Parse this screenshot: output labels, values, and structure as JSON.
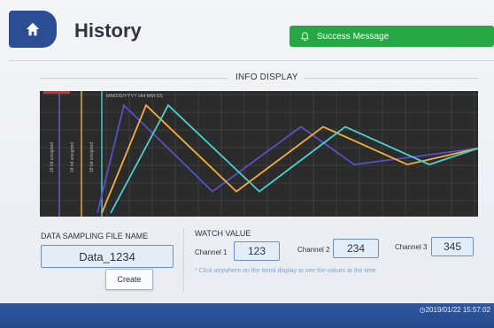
{
  "header": {
    "title": "History",
    "home_icon": "home-icon",
    "toast": {
      "text": "Success Message",
      "icon": "bell-icon",
      "color": "#27a844"
    }
  },
  "section": {
    "title": "INFO DISPLAY"
  },
  "chart": {
    "top_label": "MM/DD/YYYY HH:MM:SS",
    "axis_labels": [
      "18 bit unsigned",
      "18 bit unsigned",
      "18 bit unsigned"
    ],
    "series_colors": [
      "#5a4fc4",
      "#f2b13a",
      "#4ccfd0"
    ],
    "cursor_colors": [
      "#6a5fd0",
      "#f2b13a",
      "#4ccfd0"
    ]
  },
  "chart_data": {
    "type": "line",
    "series": [
      {
        "color": "#5a4fc4",
        "values": [
          0,
          100,
          20,
          80,
          45,
          60
        ]
      },
      {
        "color": "#f2b13a",
        "values": [
          0,
          100,
          20,
          80,
          45,
          60
        ]
      },
      {
        "color": "#4ccfd0",
        "values": [
          0,
          100,
          20,
          80,
          45,
          60
        ]
      }
    ]
  },
  "sampling": {
    "label": "DATA SAMPLING FILE NAME",
    "file_name": "Data_1234",
    "create_label": "Create"
  },
  "watch": {
    "label": "WATCH VALUE",
    "channels": [
      {
        "label": "Channel 1",
        "value": "123"
      },
      {
        "label": "Channel 2",
        "value": "234"
      },
      {
        "label": "Channel 3",
        "value": "345"
      }
    ],
    "hint": "* Click anywhere on the trend display to see the values at the time."
  },
  "footer": {
    "timestamp": "2019/01/22 15:57:02",
    "clock_icon": "clock-icon"
  }
}
